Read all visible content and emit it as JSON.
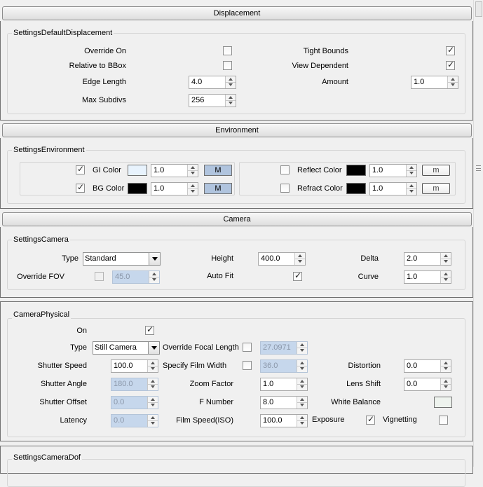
{
  "rollouts": {
    "displacement": "Displacement",
    "environment": "Environment",
    "camera": "Camera"
  },
  "displacement": {
    "group_title": "SettingsDefaultDisplacement",
    "override_on": {
      "label": "Override On",
      "checked": false
    },
    "relative_bbox": {
      "label": "Relative to BBox",
      "checked": false
    },
    "edge_length": {
      "label": "Edge Length",
      "value": "4.0"
    },
    "max_subdivs": {
      "label": "Max Subdivs",
      "value": "256"
    },
    "tight_bounds": {
      "label": "Tight Bounds",
      "checked": true
    },
    "view_dependent": {
      "label": "View Dependent",
      "checked": true
    },
    "amount": {
      "label": "Amount",
      "value": "1.0"
    }
  },
  "environment": {
    "group_title": "SettingsEnvironment",
    "gi": {
      "label": "GI Color",
      "checked": true,
      "color": "#e8f3fd",
      "value": "1.0",
      "map": "M"
    },
    "bg": {
      "label": "BG Color",
      "checked": true,
      "color": "#000000",
      "value": "1.0",
      "map": "M"
    },
    "reflect": {
      "label": "Reflect Color",
      "checked": false,
      "color": "#000000",
      "value": "1.0",
      "map": "m"
    },
    "refract": {
      "label": "Refract Color",
      "checked": false,
      "color": "#000000",
      "value": "1.0",
      "map": "m"
    }
  },
  "camera": {
    "group_title": "SettingsCamera",
    "type": {
      "label": "Type",
      "value": "Standard"
    },
    "override_fov": {
      "label": "Override FOV",
      "checked": false,
      "value": "45.0"
    },
    "height": {
      "label": "Height",
      "value": "400.0"
    },
    "auto_fit": {
      "label": "Auto Fit",
      "checked": true
    },
    "delta": {
      "label": "Delta",
      "value": "2.0"
    },
    "curve": {
      "label": "Curve",
      "value": "1.0"
    }
  },
  "physical": {
    "group_title": "CameraPhysical",
    "on": {
      "label": "On",
      "checked": true
    },
    "type": {
      "label": "Type",
      "value": "Still Camera"
    },
    "shutter_speed": {
      "label": "Shutter Speed",
      "value": "100.0"
    },
    "shutter_angle": {
      "label": "Shutter Angle",
      "value": "180.0"
    },
    "shutter_offset": {
      "label": "Shutter Offset",
      "value": "0.0"
    },
    "latency": {
      "label": "Latency",
      "value": "0.0"
    },
    "override_focal": {
      "label": "Override Focal Length",
      "checked": false,
      "value": "27.0971"
    },
    "film_width": {
      "label": "Specify Film Width",
      "checked": false,
      "value": "36.0"
    },
    "zoom": {
      "label": "Zoom Factor",
      "value": "1.0"
    },
    "fnumber": {
      "label": "F Number",
      "value": "8.0"
    },
    "film_speed": {
      "label": "Film Speed(ISO)",
      "value": "100.0"
    },
    "distortion": {
      "label": "Distortion",
      "value": "0.0"
    },
    "lens_shift": {
      "label": "Lens Shift",
      "value": "0.0"
    },
    "white_balance": {
      "label": "White Balance",
      "color": "#eef3ee"
    },
    "exposure": {
      "label": "Exposure",
      "checked": true
    },
    "vignetting": {
      "label": "Vignetting",
      "checked": false
    }
  },
  "dof": {
    "group_title": "SettingsCameraDof"
  }
}
